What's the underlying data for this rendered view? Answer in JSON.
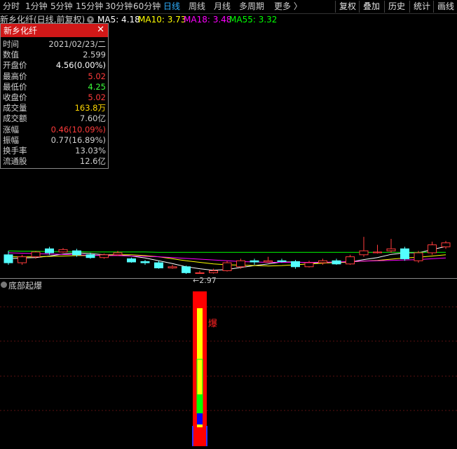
{
  "toolbar": {
    "periods": [
      "分时",
      "1分钟",
      "5分钟",
      "15分钟",
      "30分钟",
      "60分钟",
      "日线",
      "周线",
      "月线",
      "多周期",
      "更多 〉"
    ],
    "active_index": 6,
    "right_buttons": [
      "复权",
      "叠加",
      "历史",
      "统计",
      "画线"
    ]
  },
  "chart_header": {
    "stock_title": "新乡化纤(日线,前复权)",
    "ma": [
      {
        "label": "MA5: 4.18",
        "color": "#ffffff"
      },
      {
        "label": "MA10: 3.73",
        "color": "#ffff00"
      },
      {
        "label": "MA18: 3.48",
        "color": "#ff00ff"
      },
      {
        "label": "MA55: 3.32",
        "color": "#00ff00"
      }
    ]
  },
  "popup": {
    "title": "新乡化纤",
    "rows": [
      {
        "label": "时间",
        "value": "2021/02/23/二",
        "color": "#d0d0d0"
      },
      {
        "label": "数值",
        "value": "2.599",
        "color": "#d0d0d0"
      },
      {
        "label": "开盘价",
        "value": "4.56(0.00%)",
        "color": "#ffffff"
      },
      {
        "label": "最高价",
        "value": "5.02",
        "color": "#ff3b3b"
      },
      {
        "label": "最低价",
        "value": "4.25",
        "color": "#3bff3b"
      },
      {
        "label": "收盘价",
        "value": "5.02",
        "color": "#ff3b3b"
      },
      {
        "label": "成交量",
        "value": "163.8万",
        "color": "#ffd700"
      },
      {
        "label": "成交额",
        "value": "7.60亿",
        "color": "#d0d0d0"
      },
      {
        "label": " 涨幅",
        "value": "0.46(10.09%)",
        "color": "#ff3b3b"
      },
      {
        "label": " 振幅",
        "value": "0.77(16.89%)",
        "color": "#d0d0d0"
      },
      {
        "label": "换手率",
        "value": "13.03%",
        "color": "#d0d0d0"
      },
      {
        "label": "流通股",
        "value": "12.6亿",
        "color": "#d0d0d0"
      }
    ]
  },
  "low_annotation": "←2.97",
  "indicator": {
    "title": "底部起爆",
    "signal_label": "爆"
  },
  "colors": {
    "up": "#ff3b3b",
    "down": "#54ffff",
    "ma5": "#ffffff",
    "ma10": "#ffff00",
    "ma18": "#ff00ff",
    "ma55": "#00ff00"
  },
  "chart_data": {
    "type": "candlestick",
    "price_range": [
      2.9,
      5.1
    ],
    "candles": [
      {
        "o": 3.45,
        "h": 3.55,
        "l": 3.2,
        "c": 3.25
      },
      {
        "o": 3.25,
        "h": 3.45,
        "l": 3.2,
        "c": 3.4
      },
      {
        "o": 3.4,
        "h": 3.55,
        "l": 3.35,
        "c": 3.52
      },
      {
        "o": 3.6,
        "h": 3.65,
        "l": 3.45,
        "c": 3.5
      },
      {
        "o": 3.52,
        "h": 3.62,
        "l": 3.5,
        "c": 3.58
      },
      {
        "o": 3.55,
        "h": 3.6,
        "l": 3.4,
        "c": 3.45
      },
      {
        "o": 3.45,
        "h": 3.5,
        "l": 3.35,
        "c": 3.38
      },
      {
        "o": 3.38,
        "h": 3.48,
        "l": 3.35,
        "c": 3.45
      },
      {
        "o": 3.45,
        "h": 3.55,
        "l": 3.42,
        "c": 3.5
      },
      {
        "o": 3.35,
        "h": 3.38,
        "l": 3.25,
        "c": 3.27
      },
      {
        "o": 3.28,
        "h": 3.32,
        "l": 3.2,
        "c": 3.25
      },
      {
        "o": 3.25,
        "h": 3.3,
        "l": 3.1,
        "c": 3.12
      },
      {
        "o": 3.12,
        "h": 3.2,
        "l": 3.1,
        "c": 3.15
      },
      {
        "o": 3.15,
        "h": 3.18,
        "l": 2.97,
        "c": 3.0
      },
      {
        "o": 2.98,
        "h": 3.05,
        "l": 2.97,
        "c": 3.0
      },
      {
        "o": 3.0,
        "h": 3.1,
        "l": 2.98,
        "c": 3.05
      },
      {
        "o": 3.05,
        "h": 3.3,
        "l": 3.03,
        "c": 3.25
      },
      {
        "o": 3.15,
        "h": 3.35,
        "l": 3.1,
        "c": 3.3
      },
      {
        "o": 3.3,
        "h": 3.35,
        "l": 3.2,
        "c": 3.27
      },
      {
        "o": 3.27,
        "h": 3.4,
        "l": 3.25,
        "c": 3.3
      },
      {
        "o": 3.3,
        "h": 3.35,
        "l": 3.25,
        "c": 3.28
      },
      {
        "o": 3.28,
        "h": 3.32,
        "l": 3.1,
        "c": 3.15
      },
      {
        "o": 3.15,
        "h": 3.3,
        "l": 3.13,
        "c": 3.25
      },
      {
        "o": 3.25,
        "h": 3.35,
        "l": 3.2,
        "c": 3.3
      },
      {
        "o": 3.3,
        "h": 3.35,
        "l": 3.2,
        "c": 3.22
      },
      {
        "o": 3.22,
        "h": 3.45,
        "l": 3.2,
        "c": 3.4
      },
      {
        "o": 3.45,
        "h": 3.9,
        "l": 3.4,
        "c": 3.55
      },
      {
        "o": 3.5,
        "h": 3.7,
        "l": 3.48,
        "c": 3.52
      },
      {
        "o": 3.55,
        "h": 3.85,
        "l": 3.5,
        "c": 3.6
      },
      {
        "o": 3.6,
        "h": 3.65,
        "l": 3.3,
        "c": 3.35
      },
      {
        "o": 3.3,
        "h": 3.55,
        "l": 3.25,
        "c": 3.5
      },
      {
        "o": 3.5,
        "h": 3.78,
        "l": 3.45,
        "c": 3.7
      },
      {
        "o": 3.65,
        "h": 3.8,
        "l": 3.6,
        "c": 3.75
      }
    ],
    "ma_lines": [
      {
        "name": "MA5",
        "values": [
          3.35,
          3.37,
          3.38,
          3.42,
          3.47,
          3.5,
          3.48,
          3.45,
          3.45,
          3.42,
          3.37,
          3.3,
          3.23,
          3.15,
          3.1,
          3.06,
          3.08,
          3.13,
          3.18,
          3.22,
          3.27,
          3.27,
          3.25,
          3.25,
          3.25,
          3.27,
          3.33,
          3.38,
          3.46,
          3.5,
          3.5,
          3.58,
          3.66
        ]
      },
      {
        "name": "MA10",
        "values": [
          3.4,
          3.4,
          3.4,
          3.41,
          3.42,
          3.43,
          3.43,
          3.44,
          3.45,
          3.45,
          3.43,
          3.4,
          3.35,
          3.3,
          3.26,
          3.22,
          3.2,
          3.19,
          3.18,
          3.17,
          3.18,
          3.2,
          3.22,
          3.24,
          3.26,
          3.27,
          3.29,
          3.31,
          3.34,
          3.37,
          3.39,
          3.42,
          3.45
        ]
      },
      {
        "name": "MA18",
        "values": [
          3.5,
          3.49,
          3.48,
          3.47,
          3.46,
          3.45,
          3.44,
          3.43,
          3.43,
          3.42,
          3.41,
          3.4,
          3.38,
          3.36,
          3.34,
          3.32,
          3.3,
          3.28,
          3.27,
          3.26,
          3.26,
          3.26,
          3.26,
          3.26,
          3.27,
          3.28,
          3.29,
          3.3,
          3.31,
          3.32,
          3.33,
          3.35,
          3.37
        ]
      },
      {
        "name": "MA55",
        "values": [
          3.55,
          3.54,
          3.54,
          3.53,
          3.53,
          3.53,
          3.52,
          3.52,
          3.52,
          3.52,
          3.52,
          3.51,
          3.51,
          3.51,
          3.51,
          3.51,
          3.51,
          3.51,
          3.51,
          3.51,
          3.51,
          3.51,
          3.51,
          3.51,
          3.51,
          3.51,
          3.51,
          3.51,
          3.51,
          3.51,
          3.51,
          3.51,
          3.51
        ]
      }
    ],
    "signal": {
      "candle_index": 14,
      "layers": [
        "red",
        "yellow",
        "green",
        "blue"
      ]
    }
  }
}
